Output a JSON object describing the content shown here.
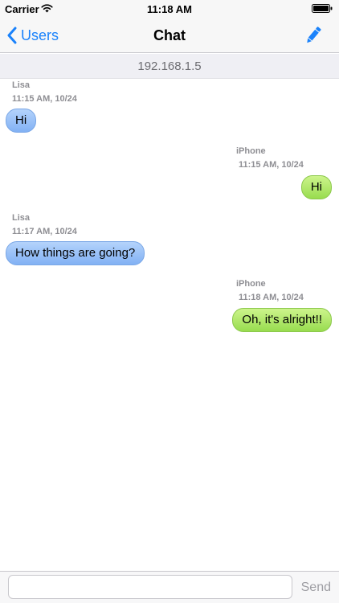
{
  "status_bar": {
    "carrier": "Carrier",
    "time": "11:18 AM",
    "wifi_icon": "wifi-icon",
    "battery_icon": "battery-icon"
  },
  "nav": {
    "back_label": "Users",
    "back_icon": "chevron-left-icon",
    "title": "Chat",
    "compose_icon": "pencil-icon"
  },
  "server": {
    "address": "192.168.1.5"
  },
  "messages": [
    {
      "direction": "incoming",
      "sender": "Lisa",
      "time": "11:15 AM, 10/24",
      "text": "Hi"
    },
    {
      "direction": "outgoing",
      "sender": "iPhone",
      "time": "11:15 AM, 10/24",
      "text": "Hi"
    },
    {
      "direction": "incoming",
      "sender": "Lisa",
      "time": "11:17 AM, 10/24",
      "text": "How things are going?"
    },
    {
      "direction": "outgoing",
      "sender": "iPhone",
      "time": "11:18 AM, 10/24",
      "text": "Oh, it's alright!!"
    }
  ],
  "composer": {
    "input_value": "",
    "input_placeholder": "",
    "send_label": "Send"
  },
  "colors": {
    "accent": "#1a82fb",
    "incoming_bubble": "#94bdf7",
    "outgoing_bubble": "#aee86a",
    "meta_text": "#8e8e93"
  }
}
